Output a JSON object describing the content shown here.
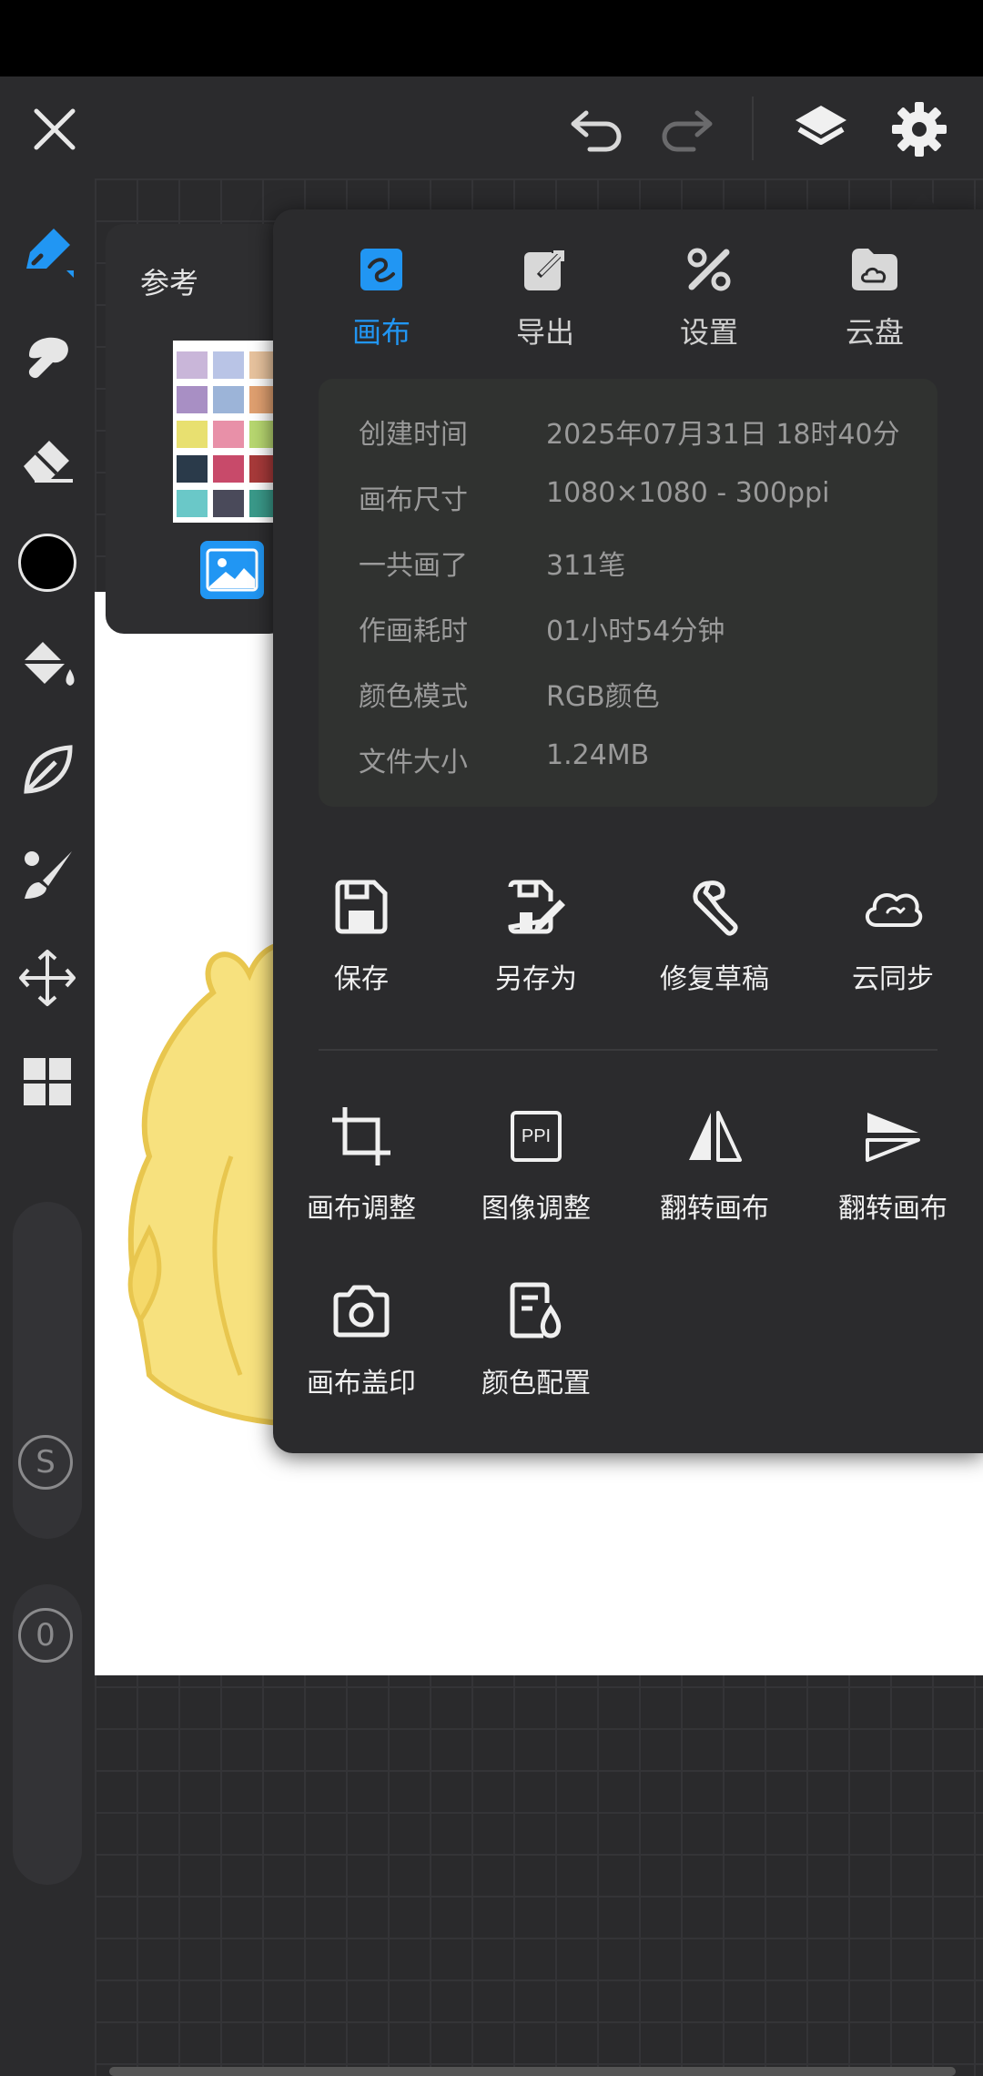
{
  "top_bar": {
    "close_icon": "close-icon",
    "undo_icon": "undo-icon",
    "redo_icon": "redo-icon",
    "layers_icon": "layers-icon",
    "settings_icon": "gear-icon"
  },
  "left_toolbar": {
    "tools": [
      "pen-icon",
      "smudge-icon",
      "eraser-icon",
      "color-swatch",
      "fill-bucket-icon",
      "leaf-icon",
      "brush-icon",
      "move-icon",
      "grid-icon"
    ],
    "current_color": "#000000",
    "size_slider_label": "S",
    "opacity_slider_label": "0"
  },
  "reference_panel": {
    "title": "参考"
  },
  "popup": {
    "tabs": [
      {
        "label": "画布",
        "icon": "canvas-icon",
        "active": true
      },
      {
        "label": "导出",
        "icon": "export-icon",
        "active": false
      },
      {
        "label": "设置",
        "icon": "tools-icon",
        "active": false
      },
      {
        "label": "云盘",
        "icon": "cloud-drive-icon",
        "active": false
      }
    ],
    "info": [
      {
        "label": "创建时间",
        "value": "2025年07月31日 18时40分"
      },
      {
        "label": "画布尺寸",
        "value": "1080×1080 - 300ppi"
      },
      {
        "label": "一共画了",
        "value": "311笔"
      },
      {
        "label": "作画耗时",
        "value": "01小时54分钟"
      },
      {
        "label": "颜色模式",
        "value": "RGB颜色"
      },
      {
        "label": "文件大小",
        "value": "1.24MB"
      }
    ],
    "actions_row1": [
      {
        "label": "保存",
        "icon": "save-icon"
      },
      {
        "label": "另存为",
        "icon": "save-as-icon"
      },
      {
        "label": "修复草稿",
        "icon": "wrench-icon"
      },
      {
        "label": "云同步",
        "icon": "cloud-sync-icon"
      }
    ],
    "actions_row2": [
      {
        "label": "画布调整",
        "icon": "crop-icon"
      },
      {
        "label": "图像调整",
        "icon": "ppi-icon"
      },
      {
        "label": "翻转画布",
        "icon": "flip-horizontal-icon"
      },
      {
        "label": "翻转画布",
        "icon": "flip-vertical-icon"
      }
    ],
    "actions_row3": [
      {
        "label": "画布盖印",
        "icon": "camera-icon"
      },
      {
        "label": "颜色配置",
        "icon": "color-profile-icon"
      }
    ],
    "ppi_text": "PPI"
  },
  "colors": {
    "accent": "#2196f3",
    "panel_bg": "#2b2b2d",
    "info_bg": "#303230",
    "canvas_bg": "#ffffff",
    "character_yellow": "#f7dc74"
  }
}
